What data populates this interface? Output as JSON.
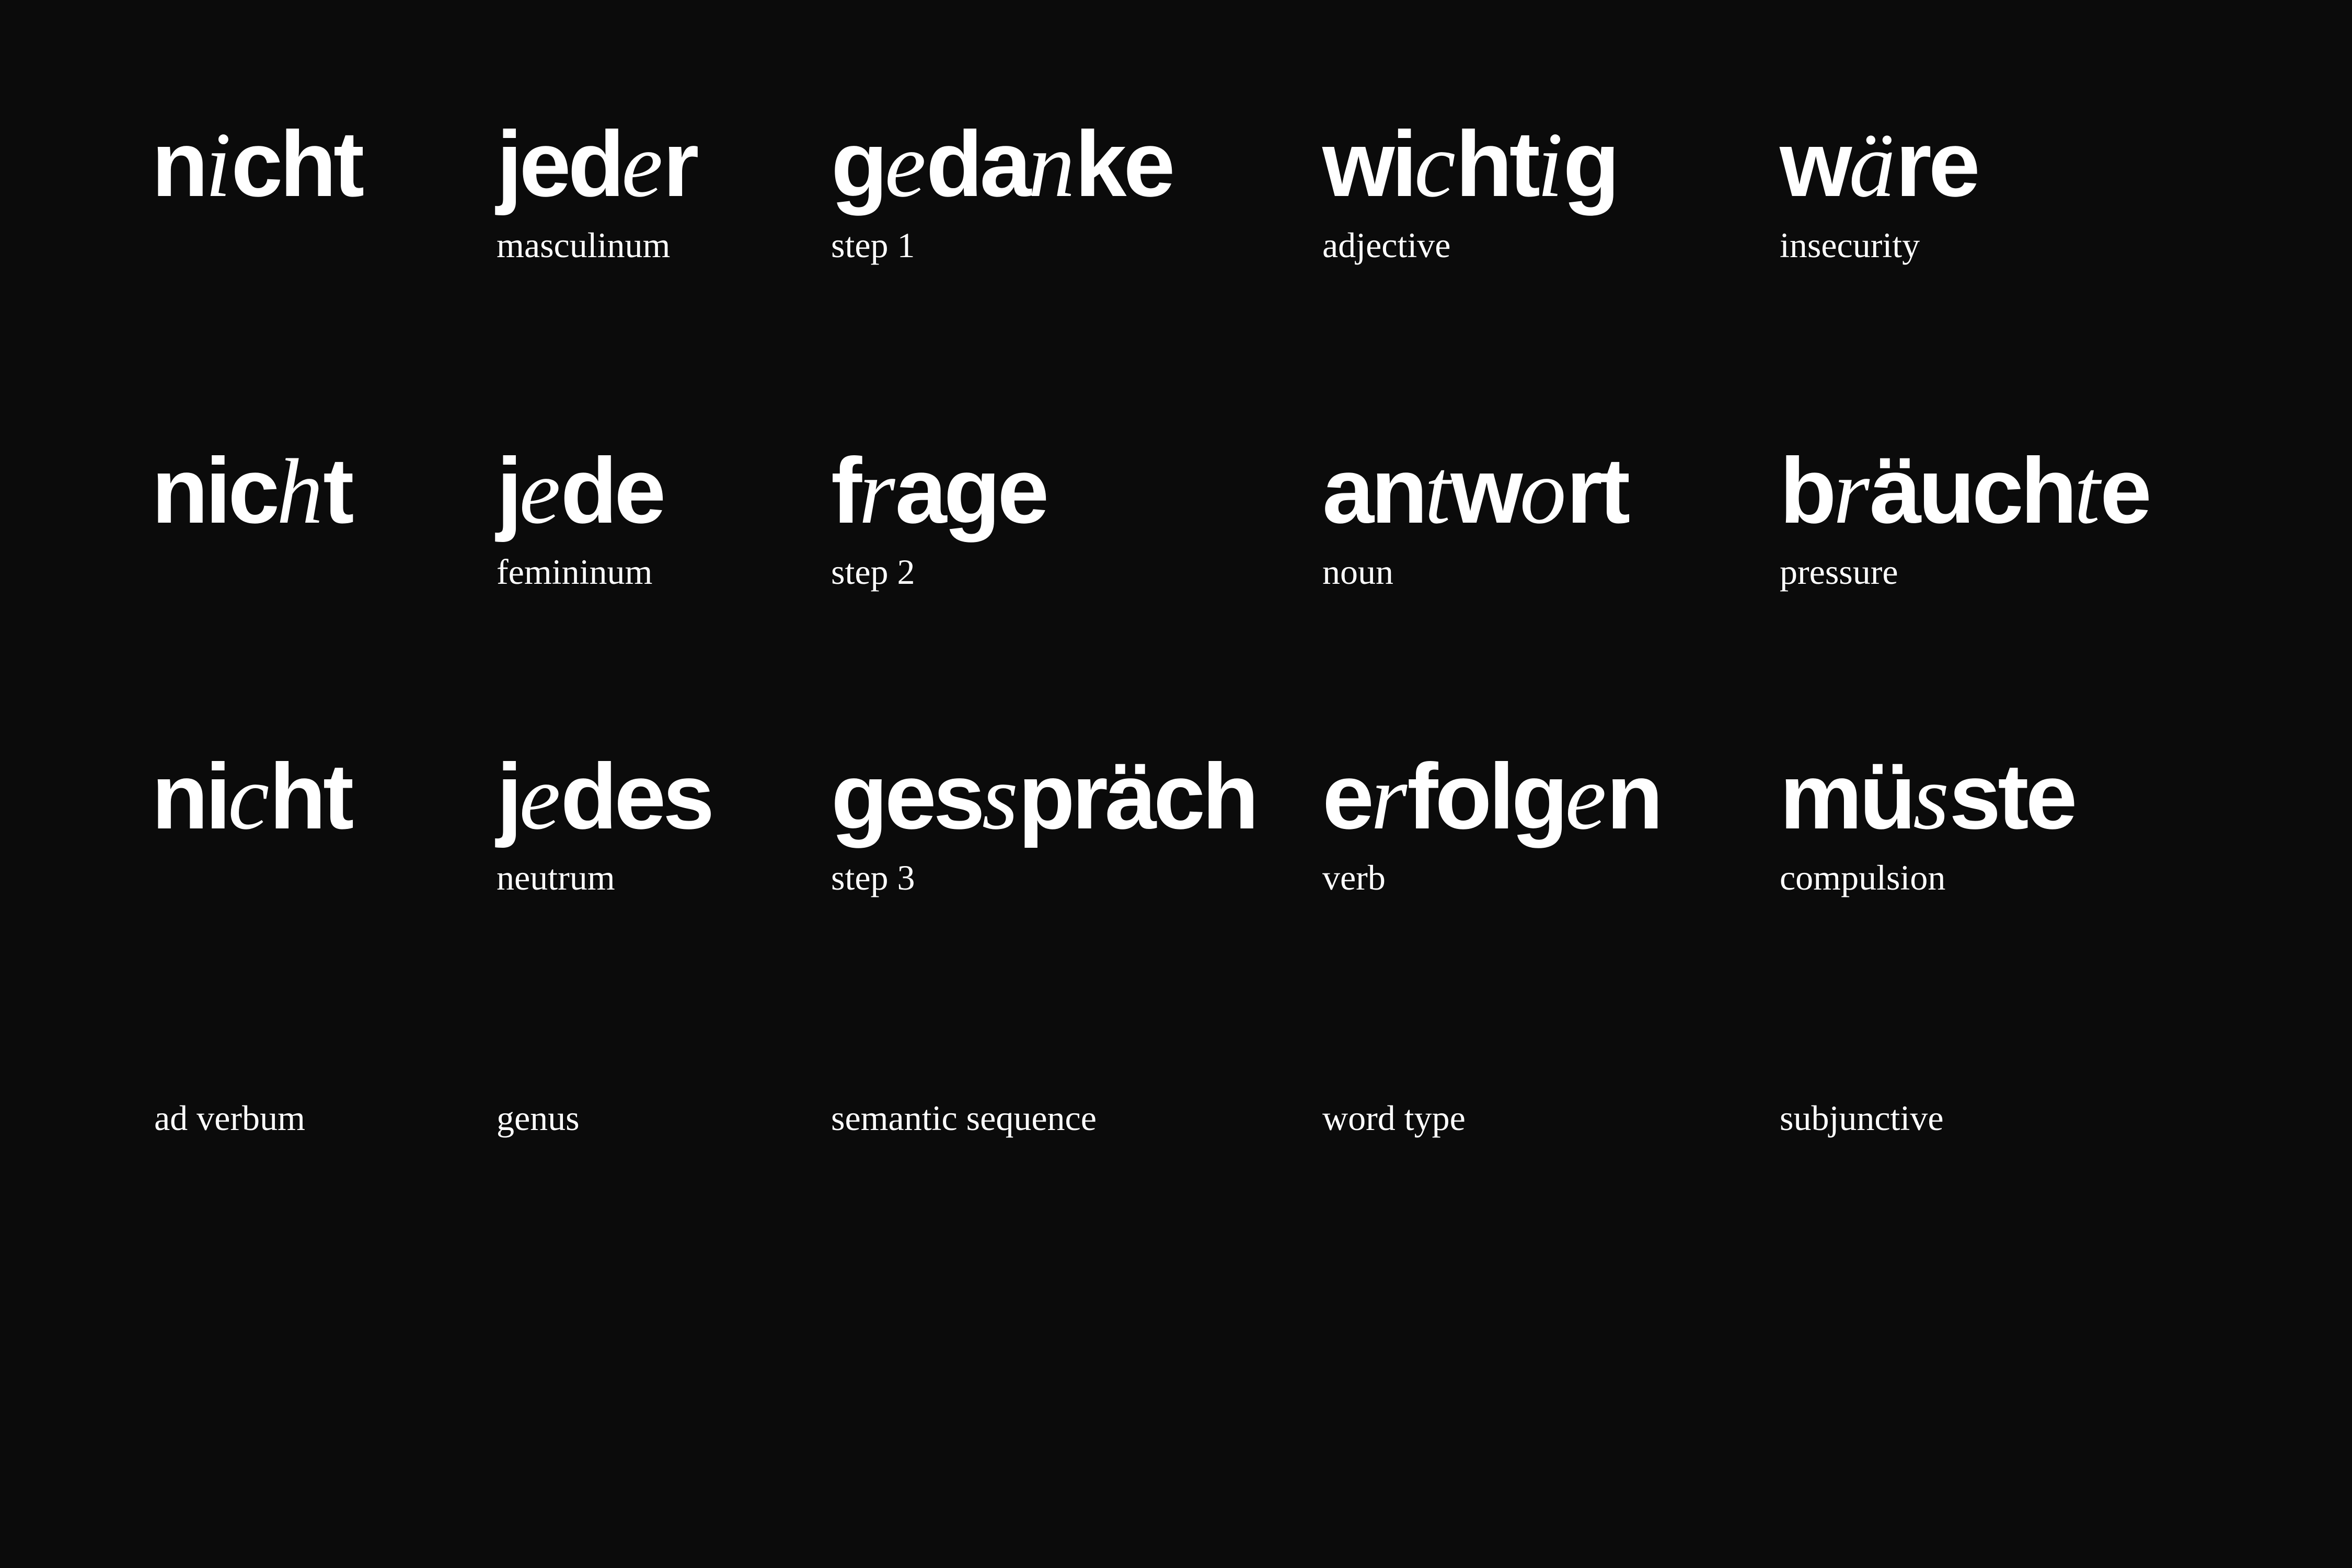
{
  "background_color": "#0b0b0b",
  "text_color": "#ffffff",
  "columns": [
    {
      "footer": "ad verbum",
      "rows": [
        {
          "word": [
            {
              "t": "n"
            },
            {
              "t": "i",
              "i": true
            },
            {
              "t": "cht"
            }
          ],
          "label": ""
        },
        {
          "word": [
            {
              "t": "nic"
            },
            {
              "t": "h",
              "i": true
            },
            {
              "t": "t"
            }
          ],
          "label": ""
        },
        {
          "word": [
            {
              "t": "ni"
            },
            {
              "t": "c",
              "i": true
            },
            {
              "t": "ht"
            }
          ],
          "label": ""
        }
      ]
    },
    {
      "footer": "genus",
      "rows": [
        {
          "word": [
            {
              "t": "jed"
            },
            {
              "t": "e",
              "i": true
            },
            {
              "t": "r"
            }
          ],
          "label": "masculinum"
        },
        {
          "word": [
            {
              "t": "j"
            },
            {
              "t": "e",
              "i": true
            },
            {
              "t": "de"
            }
          ],
          "label": "femininum"
        },
        {
          "word": [
            {
              "t": "j"
            },
            {
              "t": "e",
              "i": true
            },
            {
              "t": "des"
            }
          ],
          "label": "neutrum"
        }
      ]
    },
    {
      "footer": "semantic sequence",
      "rows": [
        {
          "word": [
            {
              "t": "g"
            },
            {
              "t": "e",
              "i": true
            },
            {
              "t": "da"
            },
            {
              "t": "n",
              "i": true
            },
            {
              "t": "ke"
            }
          ],
          "label": "step 1"
        },
        {
          "word": [
            {
              "t": "f"
            },
            {
              "t": "r",
              "i": true
            },
            {
              "t": "age"
            }
          ],
          "label": "step 2"
        },
        {
          "word": [
            {
              "t": "ges"
            },
            {
              "t": "s",
              "i": true
            },
            {
              "t": "präch"
            }
          ],
          "label": "step 3"
        }
      ]
    },
    {
      "footer": "word type",
      "rows": [
        {
          "word": [
            {
              "t": "wi"
            },
            {
              "t": "c",
              "i": true
            },
            {
              "t": "ht"
            },
            {
              "t": "i",
              "i": true
            },
            {
              "t": "g"
            }
          ],
          "label": "adjective"
        },
        {
          "word": [
            {
              "t": "an"
            },
            {
              "t": "t",
              "i": true
            },
            {
              "t": "w"
            },
            {
              "t": "o",
              "i": true
            },
            {
              "t": "rt"
            }
          ],
          "label": "noun"
        },
        {
          "word": [
            {
              "t": "e"
            },
            {
              "t": "r",
              "i": true
            },
            {
              "t": "folg"
            },
            {
              "t": "e",
              "i": true
            },
            {
              "t": "n"
            }
          ],
          "label": "verb"
        }
      ]
    },
    {
      "footer": "subjunctive",
      "rows": [
        {
          "word": [
            {
              "t": "w"
            },
            {
              "t": "ä",
              "i": true
            },
            {
              "t": "re"
            }
          ],
          "label": "insecurity"
        },
        {
          "word": [
            {
              "t": "b"
            },
            {
              "t": "r",
              "i": true
            },
            {
              "t": "äuch"
            },
            {
              "t": "t",
              "i": true
            },
            {
              "t": "e"
            }
          ],
          "label": "pressure"
        },
        {
          "word": [
            {
              "t": "mü"
            },
            {
              "t": "s",
              "i": true
            },
            {
              "t": "ste"
            }
          ],
          "label": "compulsion"
        }
      ]
    }
  ]
}
